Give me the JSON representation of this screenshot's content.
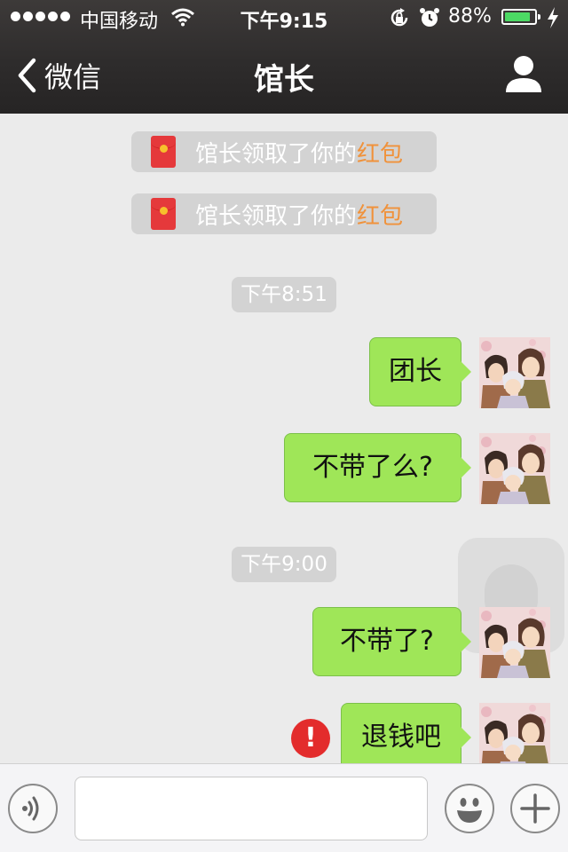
{
  "status_bar": {
    "carrier": "中国移动",
    "time": "下午9:15",
    "battery_percent": "88%",
    "battery_level": 0.88
  },
  "nav": {
    "back_label": "微信",
    "title": "馆长"
  },
  "notices": [
    {
      "prefix": "馆长领取了你的",
      "highlight": "红包"
    },
    {
      "prefix": "馆长领取了你的",
      "highlight": "红包"
    }
  ],
  "timestamps": [
    "下午8:51",
    "下午9:00"
  ],
  "messages": [
    {
      "text": "团长"
    },
    {
      "text": "不带了么?"
    },
    {
      "text": "不带了?"
    },
    {
      "text": "退钱吧",
      "failed": true,
      "error_mark": "!"
    }
  ],
  "input": {
    "value": "",
    "placeholder": ""
  },
  "icons": {
    "back": "chevron-left-icon",
    "profile": "person-icon",
    "voice": "voice-icon",
    "emoji": "emoji-icon",
    "plus": "plus-icon",
    "error": "error-icon",
    "red_packet": "red-envelope-icon"
  },
  "colors": {
    "bubble": "#9fe658",
    "highlight": "#f0923b",
    "error": "#e32c2c",
    "battery": "#4cd964"
  }
}
